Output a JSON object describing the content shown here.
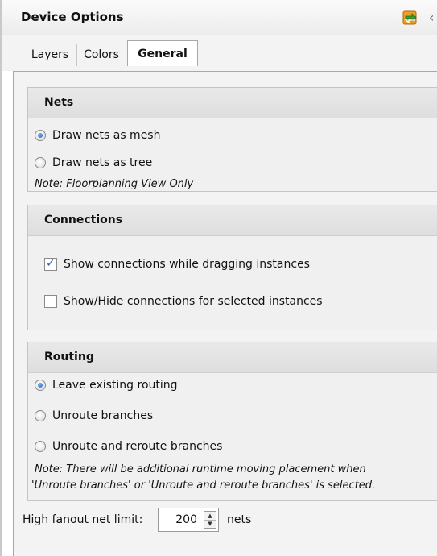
{
  "panel": {
    "title": "Device Options",
    "title_icons": [
      "sync-icon",
      "overflow-icon"
    ]
  },
  "tabs": [
    {
      "label": "Layers",
      "selected": false
    },
    {
      "label": "Colors",
      "selected": false
    },
    {
      "label": "General",
      "selected": true
    }
  ],
  "nets": {
    "header": "Nets",
    "options": [
      {
        "label": "Draw nets as mesh",
        "checked": true
      },
      {
        "label": "Draw nets as tree",
        "checked": false
      }
    ],
    "note": "Note: Floorplanning View Only"
  },
  "connections": {
    "header": "Connections",
    "options": [
      {
        "label": "Show connections while dragging instances",
        "checked": true
      },
      {
        "label": "Show/Hide connections for selected instances",
        "checked": false
      }
    ]
  },
  "routing": {
    "header": "Routing",
    "options": [
      {
        "label": "Leave existing routing",
        "checked": true
      },
      {
        "label": "Unroute branches",
        "checked": false
      },
      {
        "label": "Unroute and reroute branches",
        "checked": false
      }
    ],
    "note_line1": "Note: There will be additional runtime moving placement when",
    "note_line2": "'Unroute branches' or 'Unroute and reroute branches' is selected."
  },
  "fanout": {
    "label": "High fanout net limit:",
    "value": "200",
    "unit": "nets"
  },
  "colors": {
    "accent": "#1e5fbf",
    "group_header": "#e3e3e3",
    "panel_bg": "#f3f3f3"
  }
}
